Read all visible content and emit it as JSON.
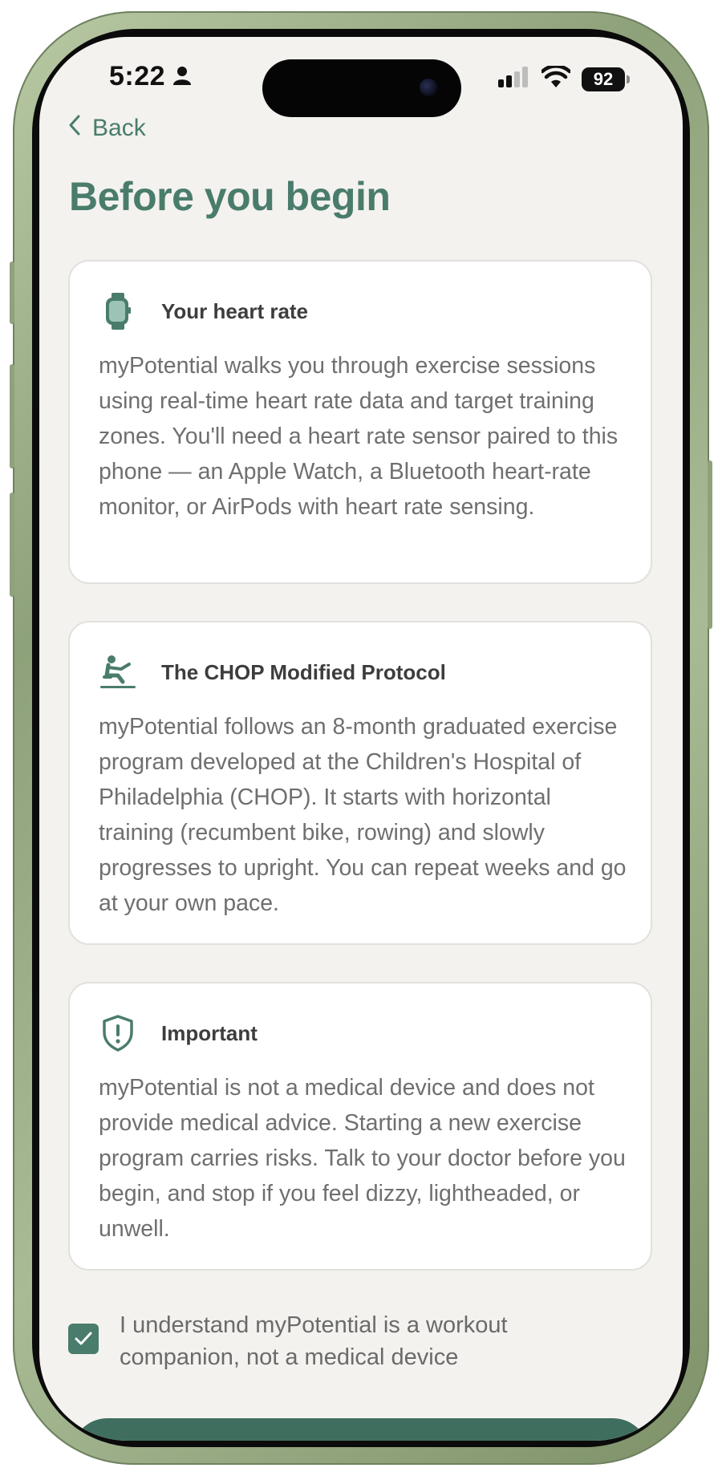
{
  "status_bar": {
    "time": "5:22",
    "battery": "92"
  },
  "nav": {
    "back_label": "Back"
  },
  "page": {
    "title": "Before you begin"
  },
  "cards": [
    {
      "icon": "watch-icon",
      "title": "Your heart rate",
      "body": "myPotential walks you through exercise sessions using real-time heart rate data and target training zones. You'll need a heart rate sensor paired to this phone — an Apple Watch, a Bluetooth heart-rate monitor, or AirPods with heart rate sensing."
    },
    {
      "icon": "rowing-icon",
      "title": "The CHOP Modified Protocol",
      "body": "myPotential follows an 8-month graduated exercise program developed at the Children's Hospital of Philadelphia (CHOP). It starts with horizontal training (recumbent bike, rowing) and slowly progresses to upright. You can repeat weeks and go at your own pace."
    },
    {
      "icon": "shield-alert-icon",
      "title": "Important",
      "body": "myPotential is not a medical device and does not provide medical advice. Starting a new exercise program carries risks. Talk to your doctor before you begin, and stop if you feel dizzy, lightheaded, or unwell."
    }
  ],
  "acknowledgement": {
    "checked": true,
    "label": "I understand myPotential is a workout companion, not a medical device"
  },
  "colors": {
    "accent": "#4a7c6c",
    "button": "#3f6e5f",
    "background": "#f3f2ef",
    "card": "#ffffff"
  }
}
